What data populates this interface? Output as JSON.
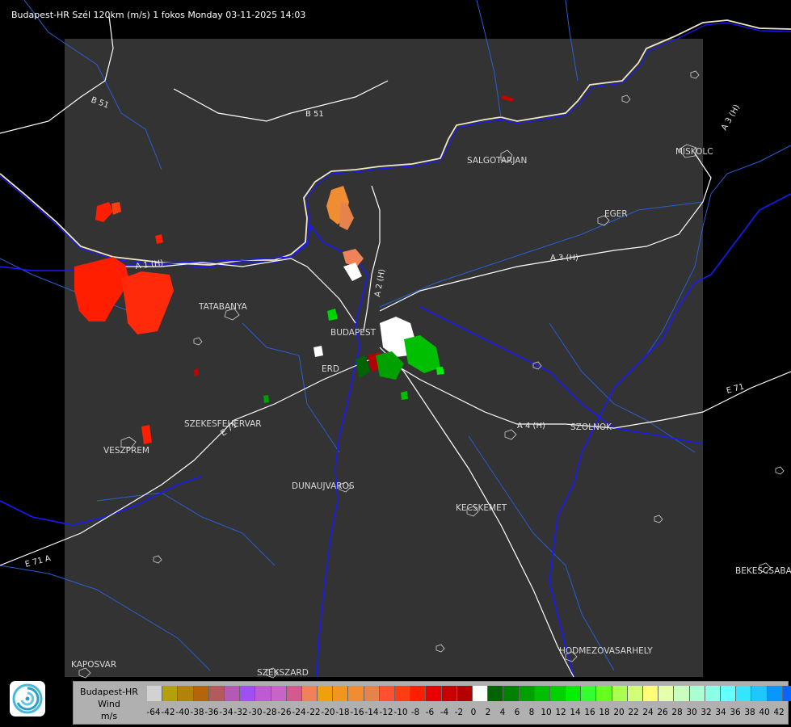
{
  "header": {
    "title": "Budapest-HR Szél 120km (m/s) 1 fokos Monday 03-11-2025 14:03"
  },
  "map": {
    "cities": [
      {
        "name": "SALGOTARJAN"
      },
      {
        "name": "MISKOLC"
      },
      {
        "name": "EGER"
      },
      {
        "name": "TATABANYA"
      },
      {
        "name": "BUDAPEST"
      },
      {
        "name": "ERD"
      },
      {
        "name": "SZEKESFEHERVAR"
      },
      {
        "name": "VESZPREM"
      },
      {
        "name": "DUNAUJVAROS"
      },
      {
        "name": "KECSKEMET"
      },
      {
        "name": "SZOLNOK"
      },
      {
        "name": "BEKESCSABA"
      },
      {
        "name": "HODMEZOVASARHELY"
      },
      {
        "name": "KAPOSVAR"
      },
      {
        "name": "SZEKSZARD"
      }
    ],
    "roads": [
      "B 51",
      "B 51",
      "A 3 (H)",
      "A 3 (H)",
      "A 4 (H)",
      "E 71",
      "A 2 (H)",
      "E 71",
      "A 1 (H)",
      "E 71 A"
    ],
    "colors": {
      "background": "#000000",
      "coverage": "#333333",
      "river": "#1a1aff",
      "border": "#2563c9",
      "road": "#ffffff"
    }
  },
  "legend": {
    "title_line1": "Budapest-HR",
    "title_line2": "Wind",
    "title_line3": "m/s",
    "colors": [
      "#d2d2d2",
      "#b4a00a",
      "#b4820a",
      "#b4640a",
      "#b45a5a",
      "#b45ab4",
      "#a050f0",
      "#be5ad2",
      "#c864c8",
      "#d25a8c",
      "#f0825a",
      "#f0a00a",
      "#f0961e",
      "#f08c32",
      "#e6824b",
      "#ff5032",
      "#ff3c14",
      "#ff1e00",
      "#eb0000",
      "#c80000",
      "#b40000",
      "#ffffff",
      "#006400",
      "#008200",
      "#00a000",
      "#00be00",
      "#00d200",
      "#00f000",
      "#32ff32",
      "#64ff1e",
      "#aaff50",
      "#d2ff78",
      "#ffff78",
      "#e6ffaa",
      "#c8ffbe",
      "#aaffd2",
      "#8cffe6",
      "#64ffff",
      "#32e6ff",
      "#1ec8ff",
      "#0a96ff",
      "#0a64ff",
      "#0028ff",
      "#0000ff"
    ],
    "ticks": [
      "-64",
      "-42",
      "-40",
      "-38",
      "-36",
      "-34",
      "-32",
      "-30",
      "-28",
      "-26",
      "-24",
      "-22",
      "-20",
      "-18",
      "-16",
      "-14",
      "-12",
      "-10",
      "-8",
      "-6",
      "-4",
      "-2",
      "0",
      "2",
      "4",
      "6",
      "8",
      "10",
      "12",
      "14",
      "16",
      "18",
      "20",
      "22",
      "24",
      "26",
      "28",
      "30",
      "32",
      "34",
      "36",
      "38",
      "40",
      "42"
    ]
  }
}
